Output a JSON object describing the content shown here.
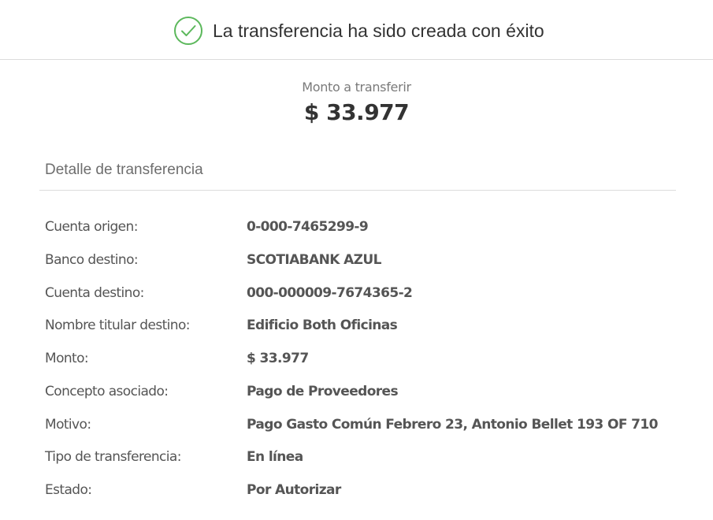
{
  "header": {
    "icon": "check-circle-icon",
    "success_message": "La transferencia ha sido creada con éxito",
    "accent_color": "#5cb85c"
  },
  "amount": {
    "label": "Monto a transferir",
    "value": "$ 33.977"
  },
  "details": {
    "title": "Detalle de transferencia",
    "rows": [
      {
        "label": "Cuenta origen:",
        "value": "0-000-7465299-9"
      },
      {
        "label": "Banco destino:",
        "value": "SCOTIABANK AZUL"
      },
      {
        "label": "Cuenta destino:",
        "value": "000-000009-7674365-2"
      },
      {
        "label": "Nombre titular destino:",
        "value": "Edificio Both Oficinas"
      },
      {
        "label": "Monto:",
        "value": "$ 33.977"
      },
      {
        "label": "Concepto asociado:",
        "value": "Pago de Proveedores"
      },
      {
        "label": "Motivo:",
        "value": "Pago Gasto Común Febrero 23, Antonio Bellet 193 OF 710"
      },
      {
        "label": "Tipo de transferencia:",
        "value": "En línea"
      },
      {
        "label": "Estado:",
        "value": "Por Autorizar"
      }
    ]
  }
}
